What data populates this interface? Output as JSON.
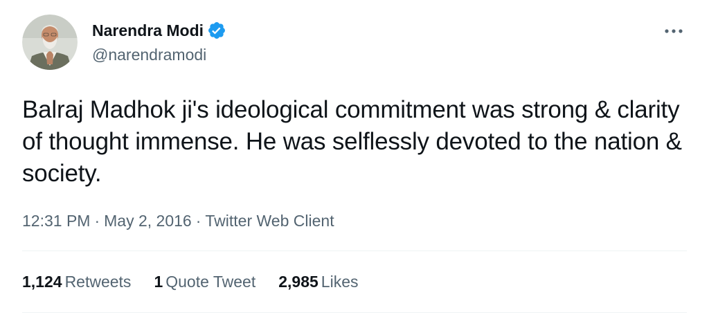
{
  "author": {
    "display_name": "Narendra Modi",
    "handle": "@narendramodi",
    "verified": true,
    "avatar_icon": "profile-photo"
  },
  "tweet": {
    "text": "Balraj Madhok ji's ideological commitment was strong & clarity of thought immense. He was selflessly devoted to the nation & society.",
    "time": "12:31 PM",
    "date": "May 2, 2016",
    "source": "Twitter Web Client",
    "separator": "·"
  },
  "stats": {
    "retweets_count": "1,124",
    "retweets_label": "Retweets",
    "quotes_count": "1",
    "quotes_label": "Quote Tweet",
    "likes_count": "2,985",
    "likes_label": "Likes"
  },
  "icons": {
    "more": "more-horizontal-icon",
    "verified": "verified-badge-icon"
  },
  "colors": {
    "text_primary": "#0f1419",
    "text_secondary": "#536471",
    "verified_blue": "#1d9bf0",
    "divider": "#eff3f4"
  }
}
